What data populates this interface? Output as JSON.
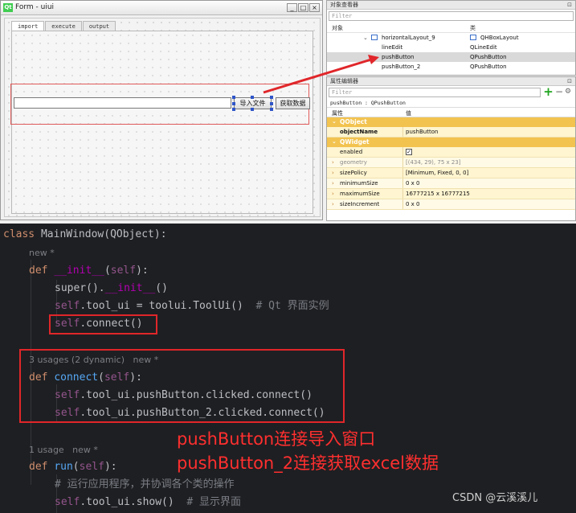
{
  "designer": {
    "window": {
      "logo": "Qt",
      "title": "Form - uiui",
      "min": "_",
      "max": "□",
      "close": "×"
    },
    "tabs": [
      "import",
      "execute",
      "output"
    ],
    "buttons": {
      "import": "导入文件",
      "excel": "获取数据"
    }
  },
  "object_inspector": {
    "title": "对象查看器",
    "filter_placeholder": "Filter",
    "col_object": "对象",
    "col_class": "类",
    "rows": [
      {
        "name": "horizontalLayout_9",
        "class": "QHBoxLayout"
      },
      {
        "name": "lineEdit",
        "class": "QLineEdit"
      },
      {
        "name": "pushButton",
        "class": "QPushButton"
      },
      {
        "name": "pushButton_2",
        "class": "QPushButton"
      }
    ]
  },
  "property_editor": {
    "title": "属性编辑器",
    "filter_placeholder": "Filter",
    "context": "pushButton : QPushButton",
    "col_property": "属性",
    "col_value": "值",
    "group_qobject": "QObject",
    "group_qwidget": "QWidget",
    "rows": [
      {
        "name": "objectName",
        "value": "pushButton"
      },
      {
        "name": "enabled",
        "value": "☑"
      },
      {
        "name": "geometry",
        "value": "[(434, 29), 75 x 23]"
      },
      {
        "name": "sizePolicy",
        "value": "[Minimum, Fixed, 0, 0]"
      },
      {
        "name": "minimumSize",
        "value": "0 x 0"
      },
      {
        "name": "maximumSize",
        "value": "16777215 x 16777215"
      },
      {
        "name": "sizeIncrement",
        "value": "0 x 0"
      }
    ]
  },
  "code": {
    "line1": {
      "kw": "class ",
      "name": "MainWindow",
      "rest": "(QObject):"
    },
    "hint_new1": "new *",
    "line2": {
      "kw": "def ",
      "fn": "__init__",
      "open": "(",
      "self": "self",
      "close": "):"
    },
    "line3": {
      "fn": "super",
      "rest": "().",
      "magic": "__init__",
      "end": "()"
    },
    "line4": {
      "self": "self",
      "rest": ".tool_ui = toolui.ToolUi()  ",
      "comment": "# Qt 界面实例"
    },
    "line5": {
      "self": "self",
      "rest": ".connect()"
    },
    "hint_usages": "3 usages (2 dynamic)   new *",
    "line6": {
      "kw": "def ",
      "fn": "connect",
      "open": "(",
      "self": "self",
      "close": "):"
    },
    "line7": {
      "self": "self",
      "rest": ".tool_ui.pushButton.clicked.connect()"
    },
    "line8": {
      "self": "self",
      "rest": ".tool_ui.pushButton_2.clicked.connect()"
    },
    "hint_usage1": "1 usage   new *",
    "line9": {
      "kw": "def ",
      "fn": "run",
      "open": "(",
      "self": "self",
      "close": "):"
    },
    "line10": {
      "comment": "# 运行应用程序，并协调各个类的操作"
    },
    "line11": {
      "self": "self",
      "rest": ".tool_ui.show()  ",
      "comment": "# 显示界面"
    }
  },
  "annotations": {
    "note1": "pushButton连接导入窗口",
    "note2": "pushButton_2连接获取excel数据"
  },
  "watermark": "CSDN @云溪溪儿",
  "colors": {
    "annotation_red": "#e0262a",
    "editor_bg": "#1e1f22",
    "property_group": "#f2c34f"
  }
}
